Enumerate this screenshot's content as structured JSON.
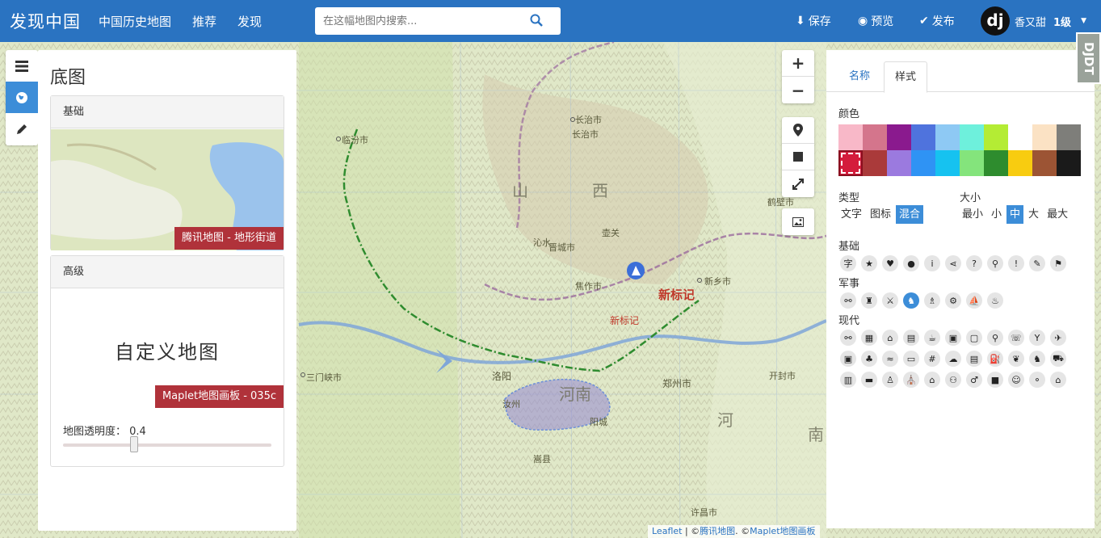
{
  "nav": {
    "brand": "发现中国",
    "links": [
      "中国历史地图",
      "推荐",
      "发现"
    ],
    "search_placeholder": "在这幅地图内搜索...",
    "actions": {
      "save": "保存",
      "preview": "预览",
      "publish": "发布"
    },
    "avatar_text": "dj",
    "username": "香又甜",
    "level": "1级"
  },
  "left_toolbar": {
    "active_index": 1
  },
  "left_panel": {
    "title": "底图",
    "basic": {
      "header": "基础",
      "tag": "腾讯地图 - 地形街道"
    },
    "advanced": {
      "header": "高级",
      "text": "自定义地图",
      "tag": "Maplet地图画板 - 035c"
    },
    "opacity_label": "地图透明度：",
    "opacity_value": "0.4",
    "opacity_level": 0.4
  },
  "right_panel": {
    "tabs": [
      "名称",
      "样式"
    ],
    "active_tab": "样式",
    "color_label": "颜色",
    "colors": [
      "#f8b8c8",
      "#d4758c",
      "#8a1a8e",
      "#4f73dd",
      "#8ec9f4",
      "#6ef0dc",
      "#b4ec34",
      "#ffffff",
      "#fbe2c4",
      "#7e7e7a",
      "#d41c3c",
      "#aa3a3a",
      "#9b7adf",
      "#2f93f4",
      "#16c2f0",
      "#84e47c",
      "#2e8c2e",
      "#f8cc10",
      "#9c5434",
      "#1a1a1a"
    ],
    "selected_color": "#d41c3c",
    "type_label": "类型",
    "types": [
      "文字",
      "图标",
      "混合"
    ],
    "type_selected": "混合",
    "size_label": "大小",
    "sizes": [
      "最小",
      "小",
      "中",
      "大",
      "最大"
    ],
    "size_selected": "中",
    "groups": [
      {
        "name": "基础",
        "icons": [
          "text-char",
          "star",
          "heart",
          "circle",
          "info",
          "share",
          "question",
          "pin",
          "exclamation",
          "pencil",
          "flag"
        ],
        "glyphs": [
          "字",
          "★",
          "♥",
          "●",
          "i",
          "⋖",
          "?",
          "⚲",
          "!",
          "✎",
          "⚑"
        ]
      },
      {
        "name": "军事",
        "icons": [
          "binoculars",
          "soldier",
          "shooter",
          "cavalry",
          "archer",
          "catapult",
          "ship",
          "fire"
        ],
        "glyphs": [
          "⚯",
          "♜",
          "⚔",
          "♞",
          "♗",
          "⚙",
          "⛵",
          "♨"
        ]
      },
      {
        "name": "现代",
        "icons": [
          "link",
          "building",
          "graduation",
          "film",
          "coffee",
          "bus",
          "train",
          "bicycle",
          "chat",
          "cocktail",
          "plane",
          "subway",
          "tree",
          "swim",
          "car",
          "fence",
          "cloud",
          "tram",
          "fuel",
          "plant",
          "animal",
          "cart",
          "book",
          "bed",
          "statue",
          "temple",
          "museum",
          "people",
          "walk",
          "lock",
          "child",
          "fork",
          "home"
        ],
        "glyphs": [
          "⚯",
          "▦",
          "⌂",
          "▤",
          "☕",
          "▣",
          "▢",
          "⚲",
          "☏",
          "Y",
          "✈",
          "▣",
          "♣",
          "≈",
          "▭",
          "#",
          "☁",
          "▤",
          "⛽",
          "❦",
          "♞",
          "⛟",
          "▥",
          "▬",
          "♙",
          "⛪",
          "⌂",
          "⚇",
          "♂",
          "■",
          "☺",
          "⚬",
          "⌂"
        ]
      }
    ]
  },
  "map": {
    "labels": [
      "临汾市",
      "长治市",
      "长治市",
      "山",
      "西",
      "晋城市",
      "焦作市",
      "新标记",
      "新标记",
      "洛阳",
      "郑州市",
      "三门峡市",
      "河南",
      "河",
      "南",
      "郑",
      "壶关",
      "沁水",
      "汝州",
      "嵩县",
      "鹤壁市",
      "新乡市",
      "开封市",
      "许昌市",
      "阳城"
    ],
    "attribution": {
      "leaflet": "Leaflet",
      "sep1": "| ©",
      "tencent": "腾讯地图",
      "sep2": ". ©",
      "maplet": "Maplet地图画板"
    }
  },
  "logo_text": "DJDT"
}
